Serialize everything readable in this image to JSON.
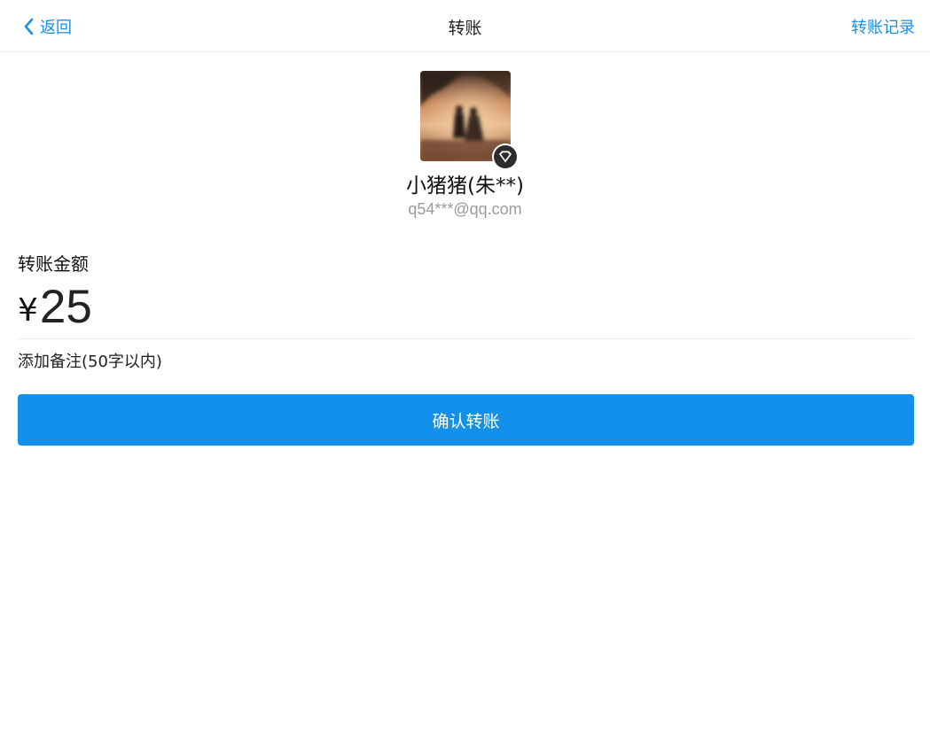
{
  "navbar": {
    "back_label": "返回",
    "title": "转账",
    "right_label": "转账记录"
  },
  "payee": {
    "name": "小猪猪(朱**)",
    "account": "q54***@qq.com",
    "badge_icon": "diamond-icon"
  },
  "amount": {
    "label": "转账金额",
    "currency": "¥",
    "value": "25"
  },
  "remark": {
    "label": "添加备注(50字以内)"
  },
  "confirm": {
    "label": "确认转账"
  },
  "colors": {
    "accent": "#1a8fe3",
    "button": "#1290eb"
  }
}
